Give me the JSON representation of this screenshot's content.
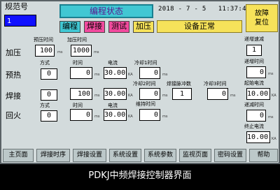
{
  "header": {
    "spec_label": "规范号",
    "spec_value": "1",
    "status_title": "编程状态",
    "date": "2018 - 7 - 5",
    "time": "11:37:48",
    "reset_label_1": "故障",
    "reset_label_2": "复位",
    "status_text": "设备正常",
    "modes": [
      {
        "label": "编程",
        "color": "#41c7d3"
      },
      {
        "label": "焊接",
        "color": "#f24a9e"
      },
      {
        "label": "测试",
        "color": "#f24a9e"
      },
      {
        "label": "加压",
        "color": "#f6e25a"
      }
    ]
  },
  "rows": {
    "pressurize": "加压",
    "preheat": "预热",
    "weld": "焊接",
    "anneal": "回火"
  },
  "labels": {
    "prepress_time": "预压时间",
    "press_time": "加压时间",
    "method": "方式",
    "time": "时间",
    "current": "电流",
    "cool1_time": "冷却1时间",
    "cool2_time": "冷却2时间",
    "weld_pulse_count": "焊接脉冲数",
    "cool3_time": "冷却3时间",
    "hold_time": "维持时间",
    "increment_rate": "递增速减",
    "ramp_up_time": "递增时间",
    "start_current": "起始电流",
    "ramp_down_time": "递减时间",
    "end_current": "终止电流"
  },
  "units": {
    "ms": "ms",
    "ka": "KA"
  },
  "values": {
    "prepress_time": "100",
    "press_time": "1000",
    "preheat_method": "0",
    "preheat_time": "0",
    "preheat_current": "30.00",
    "cool1_time": "0",
    "weld_method": "0",
    "weld_time": "100",
    "weld_current": "30.00",
    "cool2_time": "0",
    "weld_pulse_count": "1",
    "cool3_time": "0",
    "anneal_method": "0",
    "anneal_time": "0",
    "anneal_current": "30.00",
    "hold_time": "0",
    "increment_rate": "1",
    "ramp_up_time": "0",
    "start_current": "10.00",
    "ramp_down_time": "0",
    "end_current": "10.00"
  },
  "nav": [
    "主页面",
    "焊接时序",
    "焊接设置",
    "系统设置",
    "系统参数",
    "监视页面",
    "密码设置",
    "帮助"
  ],
  "caption": "PDKJ中频焊接控制器界面"
}
